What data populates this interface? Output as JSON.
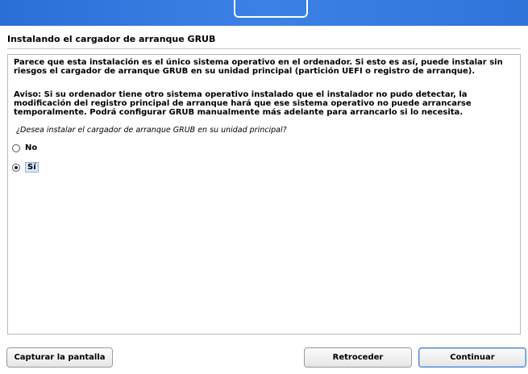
{
  "header": {
    "title": "Instalando el cargador de arranque GRUB"
  },
  "main": {
    "paragraph1": "Parece que esta instalación es el único sistema operativo en el ordenador. Si esto es así, puede instalar sin riesgos el cargador de arranque GRUB en su unidad principal (partición UEFI o registro de arranque).",
    "paragraph2": "Aviso: Si su ordenador tiene  otro sistema operativo instalado que el instalador no pudo detectar, la modificación del registro principal de arranque hará que ese sistema operativo no puede arrancarse temporalmente. Podrá configurar GRUB manualmente más adelante para arrancarlo si lo necesita.",
    "question": "¿Desea instalar el cargador de arranque GRUB en su unidad principal?",
    "options": [
      {
        "label": "No",
        "selected": false
      },
      {
        "label": "Sí",
        "selected": true
      }
    ]
  },
  "footer": {
    "capture_label": "Capturar la pantalla",
    "back_label": "Retroceder",
    "continue_label": "Continuar"
  },
  "colors": {
    "banner": "#3c82e6",
    "selection": "#dbe8fb"
  }
}
